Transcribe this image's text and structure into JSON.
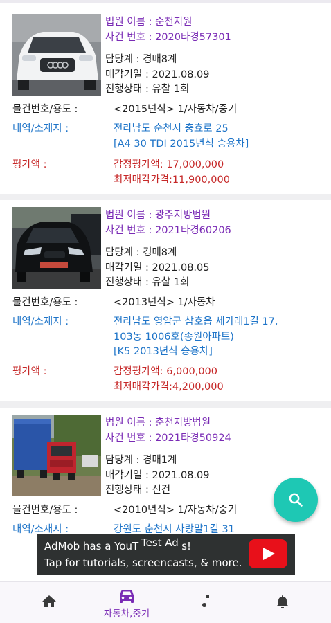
{
  "listings": [
    {
      "court_line": "법원 이름 : 순천지원",
      "case_line": "사건 번호 : 2020타경57301",
      "dept_line": "담당계 : 경매8계",
      "sale_date_line": "매각기일 : 2021.08.09",
      "status_line": "진행상태 : 유찰 1회",
      "item_label": "물건번호/용도 :",
      "item_value": "<2015년식> 1/자동차/중기",
      "address_label": "내역/소재지 :",
      "address_lines": [
        "전라남도 순천시 충효로 25",
        "[A4 30 TDI 2015년식 승용차]"
      ],
      "price_label": "평가액 :",
      "appraisal_line": "감정평가액: 17,000,000",
      "min_price_line": "최저매각가격:11,900,000"
    },
    {
      "court_line": "법원 이름 : 광주지방법원",
      "case_line": "사건 번호 : 2021타경60206",
      "dept_line": "담당계 : 경매8계",
      "sale_date_line": "매각기일 : 2021.08.05",
      "status_line": "진행상태 : 유찰 1회",
      "item_label": "물건번호/용도 :",
      "item_value": "<2013년식> 1/자동차",
      "address_label": "내역/소재지 :",
      "address_lines": [
        "전라남도 영암군 삼호읍 세가래1길 17,",
        "103동 1006호(종원아파트)",
        "[K5 2013년식 승용차]"
      ],
      "price_label": "평가액 :",
      "appraisal_line": "감정평가액: 6,000,000",
      "min_price_line": "최저매각가격:4,200,000"
    },
    {
      "court_line": "법원 이름 : 춘천지방법원",
      "case_line": "사건 번호 : 2021타경50924",
      "dept_line": "담당계 : 경매1계",
      "sale_date_line": "매각기일 : 2021.08.09",
      "status_line": "진행상태 : 신건",
      "item_label": "물건번호/용도 :",
      "item_value": "<2010년식> 1/자동차/중기",
      "address_label": "내역/소재지 :",
      "address_lines": [
        "강원도 춘천시 사랑말1길 31"
      ]
    }
  ],
  "ad": {
    "line1": "AdMob has a YouT",
    "line1_end": "s!",
    "test_label": "Test Ad",
    "line2": "Tap for tutorials, screencasts, & more.",
    "video_icon": "youtube-play-icon"
  },
  "fab": {
    "icon": "search-icon"
  },
  "nav": {
    "items": [
      {
        "icon": "home-icon",
        "label": ""
      },
      {
        "icon": "car-icon",
        "label": "자동차,중기",
        "active": true
      },
      {
        "icon": "music-note-icon",
        "label": ""
      },
      {
        "icon": "bell-icon",
        "label": ""
      }
    ]
  },
  "colors": {
    "accent": "#7a2bb5",
    "link": "#1e74c8",
    "price": "#c62828",
    "fab": "#1ec8b4"
  }
}
